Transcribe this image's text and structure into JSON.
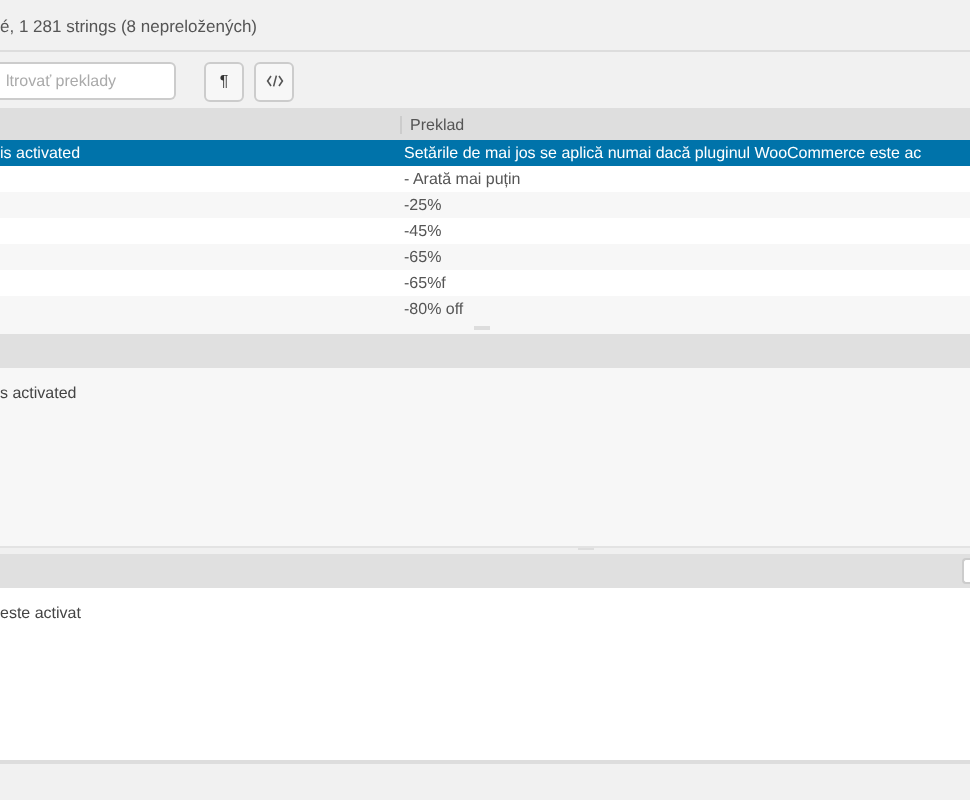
{
  "header": {
    "summary": "é, 1 281 strings (8 nepreložených)"
  },
  "toolbar": {
    "filter": {
      "placeholder": "ltrovať preklady"
    },
    "buttons": [
      {
        "kind": "pilcrow",
        "label": "¶"
      },
      {
        "kind": "code"
      }
    ]
  },
  "table": {
    "column_2": "Preklad",
    "rows": [
      {
        "source": "is activated",
        "translation": "Setările de mai jos se aplică numai dacă pluginul WooCommerce este ac",
        "selected": true
      },
      {
        "translation": "- Arată mai puțin",
        "selected": false
      },
      {
        "translation": "-25%",
        "selected": false
      },
      {
        "translation": "-45%",
        "selected": false
      },
      {
        "translation": "-65%",
        "selected": false
      },
      {
        "translation": "-65%f",
        "selected": false
      },
      {
        "translation": "-80% off",
        "selected": false
      }
    ]
  },
  "source_panel": {
    "text": "s activated"
  },
  "translation_panel": {
    "text": "este activat"
  }
}
